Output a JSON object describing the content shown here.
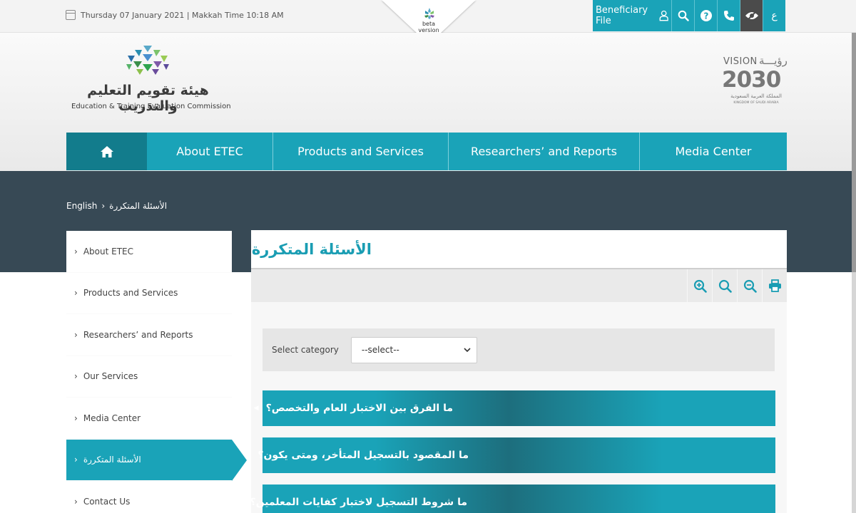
{
  "topbar": {
    "date": "Thursday 07 January 2021 | Makkah Time 10:18 AM",
    "beta_label_1": "beta",
    "beta_label_2": "version",
    "beneficiary": "Beneficiary File",
    "lang_toggle": "ع",
    "icons": [
      "user-icon",
      "search-icon",
      "help-icon",
      "phone-icon",
      "accessibility-eye-icon"
    ]
  },
  "brand": {
    "name_ar": "هيئة تقويم التعليم والتدريب",
    "name_en": "Education & Training Evaluation Commission",
    "vision_en": "VISION",
    "vision_ar": "رؤيـــة",
    "vision_year": "2030",
    "vision_kingdom_ar": "المملكة العربية السعودية",
    "vision_kingdom_en": "KINGDOM OF SAUDI ARABIA",
    "colors": {
      "accent": "#1aa3b8",
      "accent_dark": "#127c8c",
      "band": "#374955"
    }
  },
  "nav": {
    "items": [
      "About ETEC",
      "Products and Services",
      "Researchers’ and Reports",
      "Media Center"
    ]
  },
  "breadcrumb": {
    "root": "English",
    "current": "الأسئلة المتكررة"
  },
  "sidebar": {
    "items": [
      {
        "label": "About ETEC",
        "active": false
      },
      {
        "label": "Products and Services",
        "active": false
      },
      {
        "label": "Researchers’ and Reports",
        "active": false
      },
      {
        "label": "Our Services",
        "active": false
      },
      {
        "label": "Media Center",
        "active": false
      },
      {
        "label": "الأسئلة المتكررة",
        "active": true
      },
      {
        "label": "Contact Us",
        "active": false
      }
    ]
  },
  "content": {
    "title": "الأسئلة المتكررة",
    "toolbar_icons": [
      "zoom-in-icon",
      "zoom-reset-icon",
      "zoom-out-icon",
      "print-icon"
    ],
    "filter": {
      "label": "Select category",
      "selected": "--select--"
    },
    "faqs": [
      {
        "question": "ما الفرق بين الاختبار العام والتخصص؟",
        "expanded": false
      },
      {
        "question": "ما المقصود بالتسجيل المتأخر، ومتى يكون؟",
        "expanded": false
      },
      {
        "question": "ما شروط التسجيل لاختبار كفايات المعلمين؟",
        "expanded": true
      }
    ]
  }
}
